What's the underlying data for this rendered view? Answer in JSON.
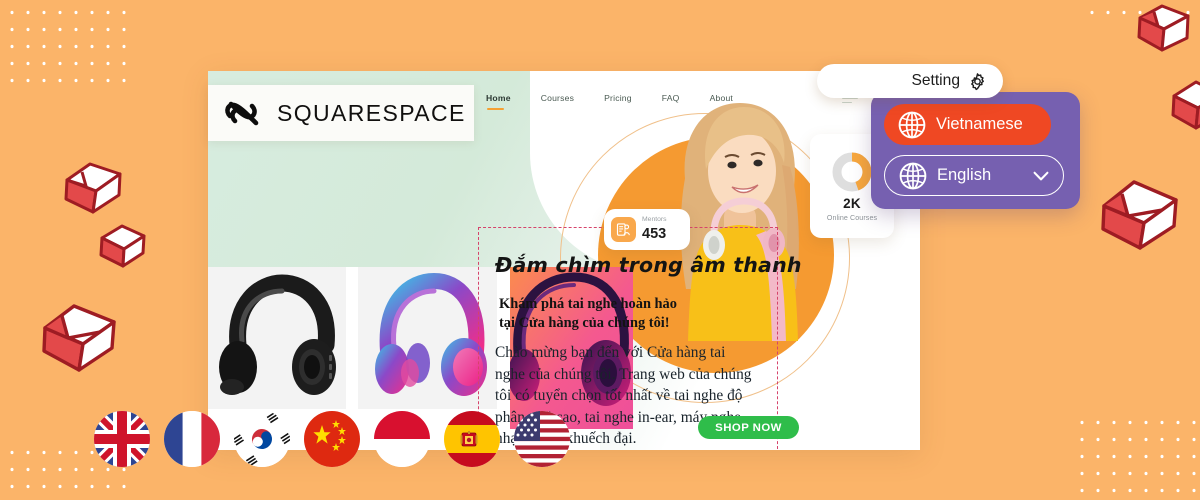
{
  "theme": {
    "background": "#fbb469",
    "card_mint": "#d7ecdf",
    "accent_orange": "#f59a31",
    "panel_purple": "#7660b0",
    "active_lang": "#ef4823",
    "shop_green": "#2fbd4a",
    "dashed_pink": "#d6436b",
    "cube_red": "#e3494a",
    "cube_outline": "#9e1c23"
  },
  "site": {
    "logo_text": "SQUARESPACE",
    "logo_icon": "squarespace-logo-icon",
    "nav": [
      {
        "label": "Home",
        "active": true
      },
      {
        "label": "Courses",
        "active": false
      },
      {
        "label": "Pricing",
        "active": false
      },
      {
        "label": "FAQ",
        "active": false
      },
      {
        "label": "About",
        "active": false
      }
    ],
    "hero": {
      "headline": "Đắm chìm trong âm thanh",
      "subhead_line1": "Khám phá tai nghe hoàn hảo",
      "subhead_line2": "tại Cửa hàng của chúng tôi!",
      "body": "Chào mừng bạn đến với Cửa hàng tai nghe của chúng tôi. Trang web của chúng tôi có tuyển chọn tốt nhất về tai nghe độ phân giải cao, tai nghe in-ear, máy nghe nhạc và bộ khuếch đại."
    },
    "stats": {
      "mentors": {
        "label": "Mentors",
        "value": "453",
        "icon": "mentor-certificate-icon"
      },
      "courses": {
        "value": "2K",
        "label": "Online Courses",
        "donut_percent": 70,
        "icon": "donut-chart-icon"
      }
    },
    "products": [
      {
        "name": "black-over-ear-headphones"
      },
      {
        "name": "pink-blue-gradient-headphones"
      },
      {
        "name": "purple-magenta-headphones"
      }
    ],
    "cta": {
      "label": "SHOP NOW"
    }
  },
  "settings": {
    "title": "Setting",
    "gear_icon": "gear-icon",
    "languages": [
      {
        "label": "Vietnamese",
        "icon": "globe-icon",
        "selected": true,
        "has_caret": false
      },
      {
        "label": "English",
        "icon": "globe-icon",
        "selected": false,
        "has_caret": true
      }
    ],
    "caret_icon": "chevron-down-icon"
  },
  "flags": [
    {
      "name": "united-kingdom",
      "code": "GB"
    },
    {
      "name": "france",
      "code": "FR"
    },
    {
      "name": "south-korea",
      "code": "KR"
    },
    {
      "name": "china",
      "code": "CN"
    },
    {
      "name": "indonesia",
      "code": "ID"
    },
    {
      "name": "spain",
      "code": "ES"
    },
    {
      "name": "united-states",
      "code": "US"
    }
  ],
  "decorations": {
    "cubes": 6,
    "dot_grids": 4
  }
}
